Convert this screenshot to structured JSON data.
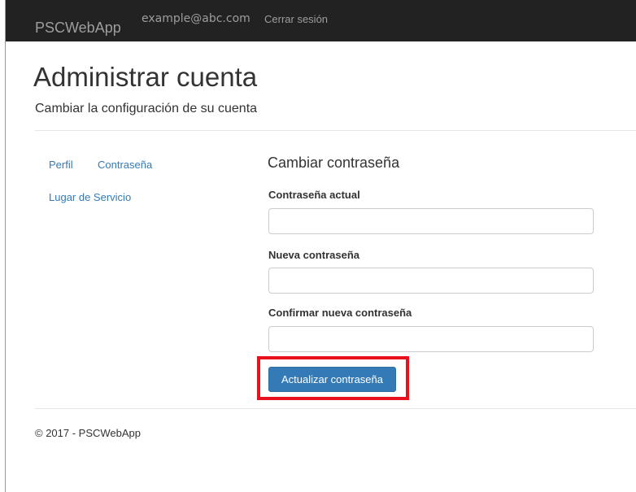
{
  "navbar": {
    "brand": "PSCWebApp",
    "user_email": "example@abc.com",
    "logout_label": "Cerrar sesión"
  },
  "page": {
    "title": "Administrar cuenta",
    "subtitle": "Cambiar la configuración de su cuenta"
  },
  "sidebar": {
    "items": [
      {
        "label": "Perfil"
      },
      {
        "label": "Contraseña"
      },
      {
        "label": "Lugar de Servicio"
      }
    ]
  },
  "form": {
    "title": "Cambiar contraseña",
    "fields": [
      {
        "label": "Contraseña actual",
        "value": ""
      },
      {
        "label": "Nueva contraseña",
        "value": ""
      },
      {
        "label": "Confirmar nueva contraseña",
        "value": ""
      }
    ],
    "submit_label": "Actualizar contraseña"
  },
  "colors": {
    "navbar_bg": "#222222",
    "link": "#337ab7",
    "primary_button": "#337ab7",
    "highlight": "#e8121e"
  },
  "footer": {
    "text": "© 2017 - PSCWebApp"
  }
}
